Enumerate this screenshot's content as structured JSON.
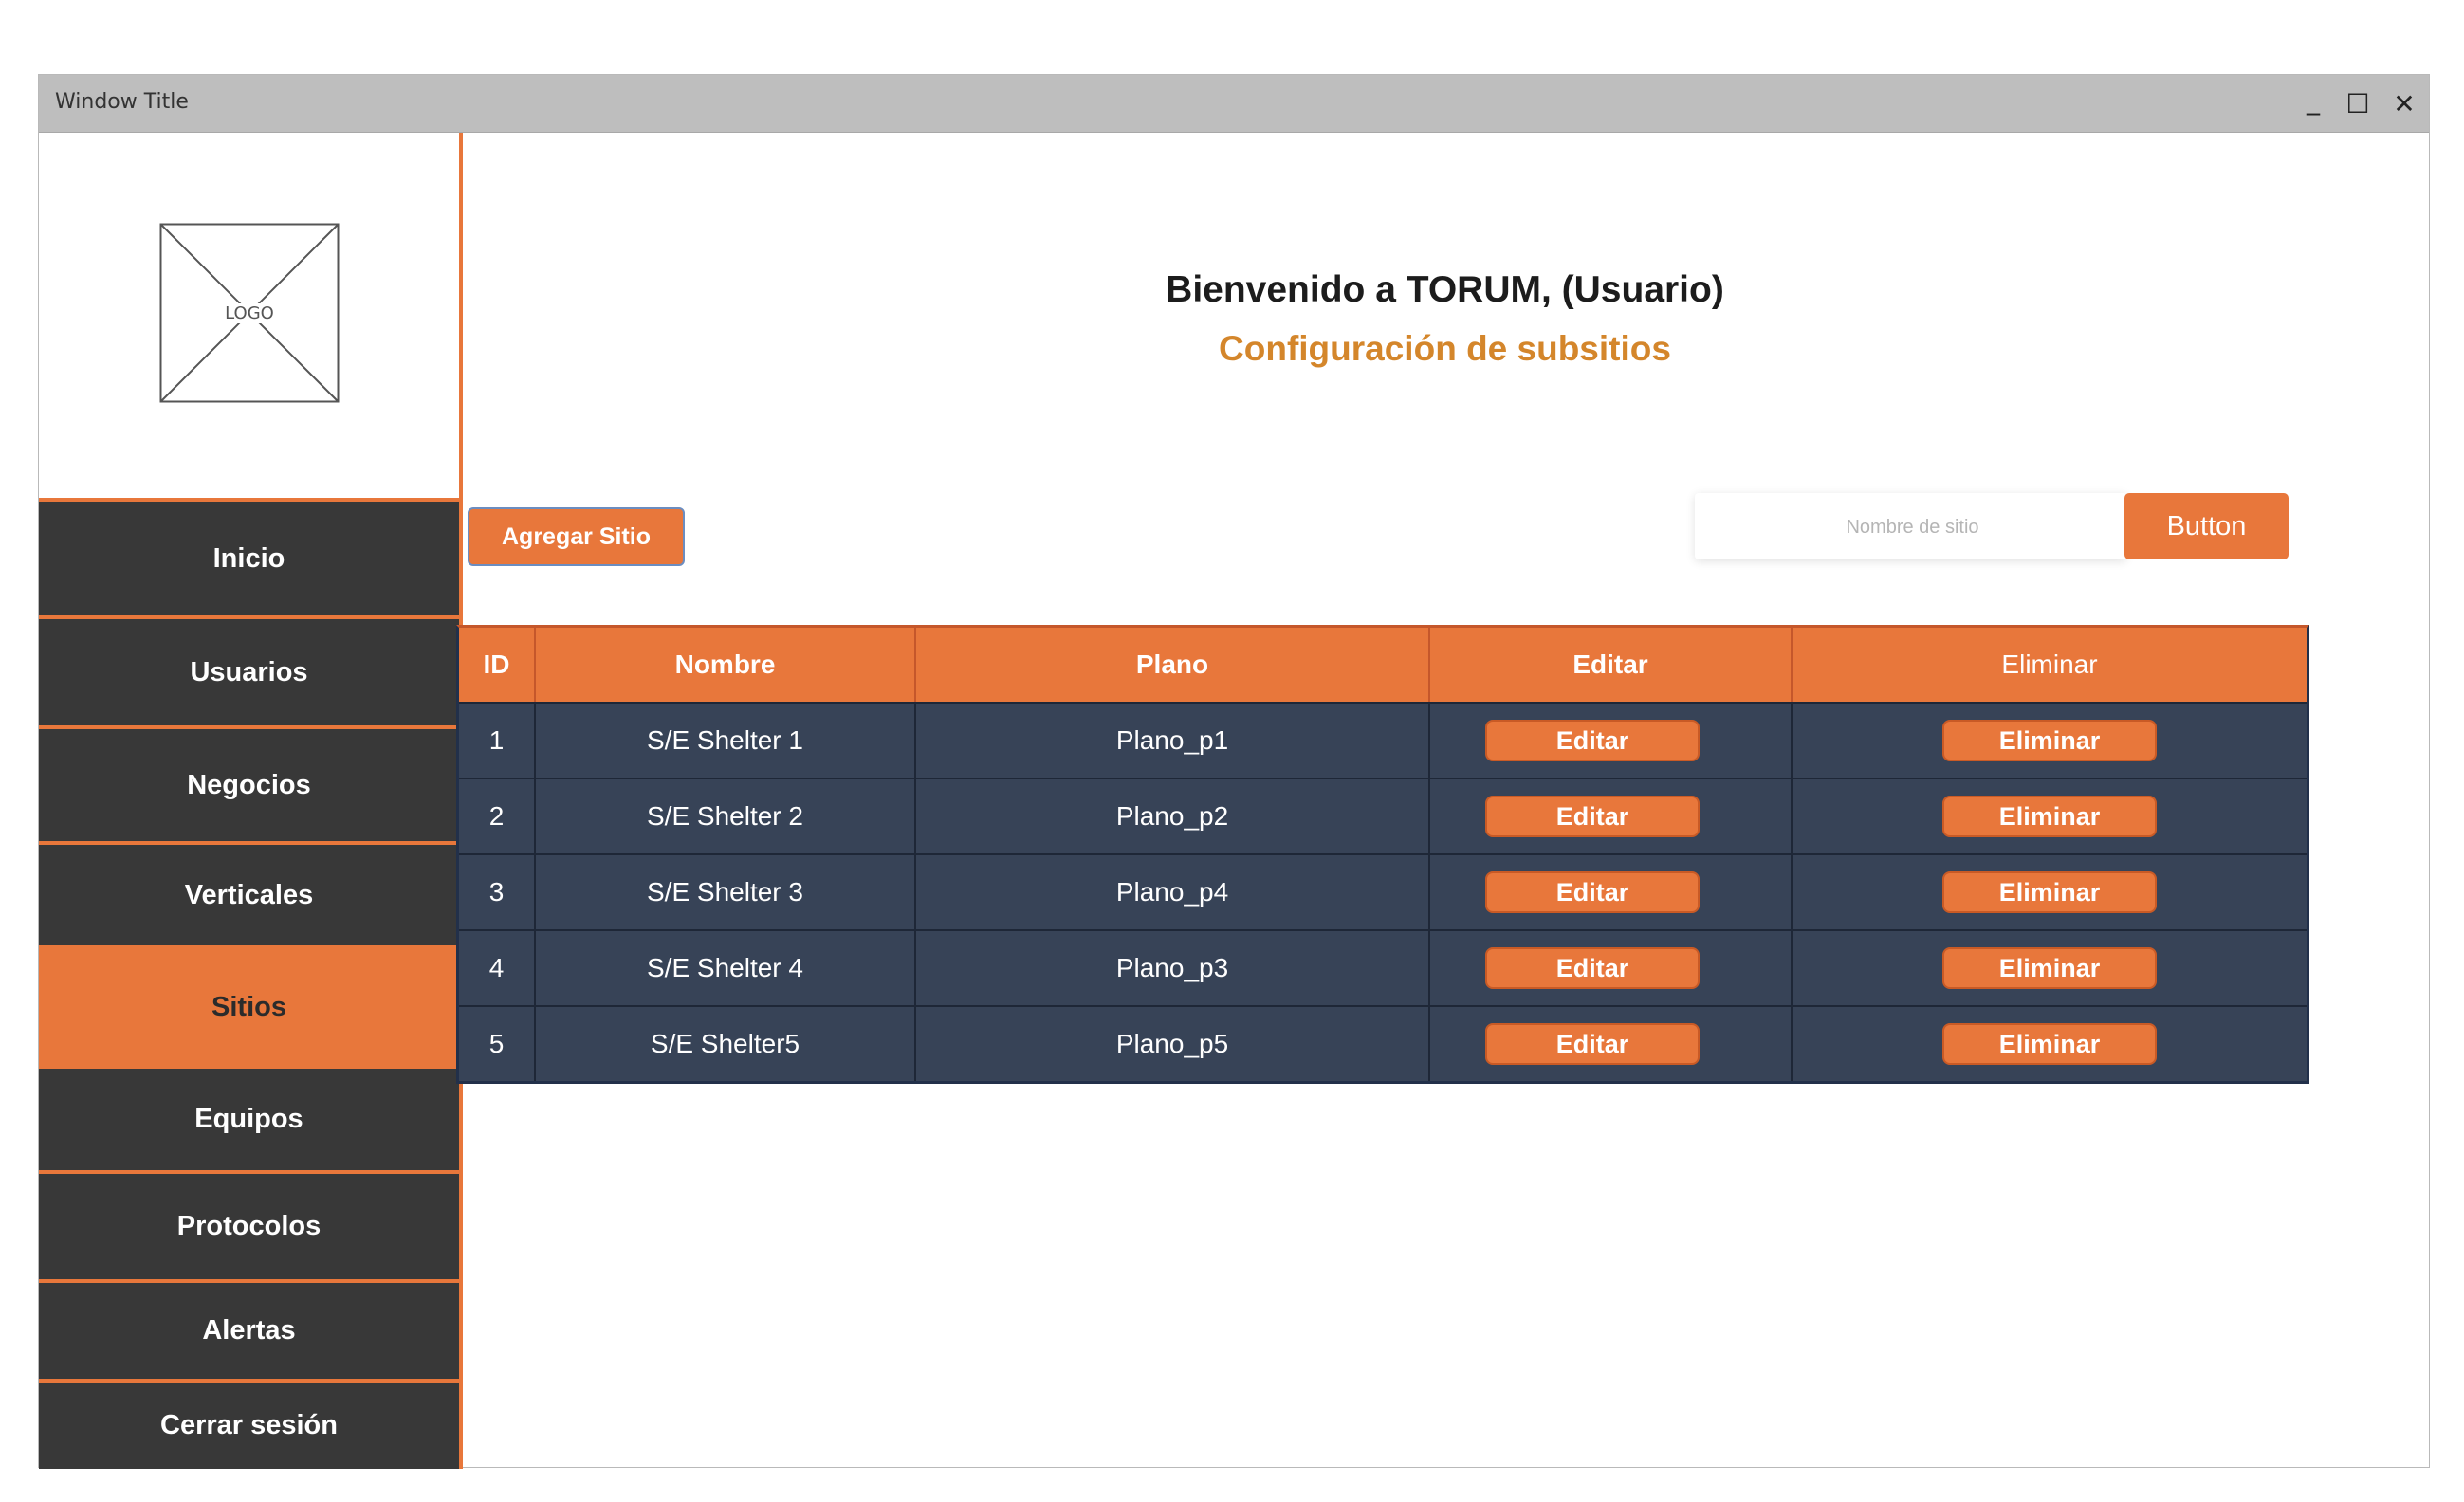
{
  "window": {
    "title": "Window Title",
    "minimize_glyph": "_",
    "maximize_glyph": "☐",
    "close_glyph": "✕"
  },
  "sidebar": {
    "logo_text": "LOGO",
    "items": [
      {
        "label": "Inicio",
        "active": false
      },
      {
        "label": "Usuarios",
        "active": false
      },
      {
        "label": "Negocios",
        "active": false
      },
      {
        "label": "Verticales",
        "active": false
      },
      {
        "label": "Sitios",
        "active": true
      },
      {
        "label": "Equipos",
        "active": false
      },
      {
        "label": "Protocolos",
        "active": false
      },
      {
        "label": "Alertas",
        "active": false
      },
      {
        "label": "Cerrar sesión",
        "active": false
      }
    ]
  },
  "main": {
    "welcome": "Bienvenido a TORUM, (Usuario)",
    "subtitle": "Configuración de subsitios",
    "add_button": "Agregar Sitio",
    "search": {
      "placeholder": "Nombre de sitio",
      "value": "",
      "button_label": "Button"
    },
    "table": {
      "columns": [
        "ID",
        "Nombre",
        "Plano",
        "Editar",
        "Eliminar"
      ],
      "rows": [
        {
          "id": "1",
          "nombre": "S/E Shelter 1",
          "plano": "Plano_p1",
          "edit_label": "Editar",
          "delete_label": "Eliminar"
        },
        {
          "id": "2",
          "nombre": "S/E Shelter 2",
          "plano": "Plano_p2",
          "edit_label": "Editar",
          "delete_label": "Eliminar"
        },
        {
          "id": "3",
          "nombre": "S/E Shelter 3",
          "plano": "Plano_p4",
          "edit_label": "Editar",
          "delete_label": "Eliminar"
        },
        {
          "id": "4",
          "nombre": "S/E Shelter 4",
          "plano": "Plano_p3",
          "edit_label": "Editar",
          "delete_label": "Eliminar"
        },
        {
          "id": "5",
          "nombre": "S/E Shelter5",
          "plano": "Plano_p5",
          "edit_label": "Editar",
          "delete_label": "Eliminar"
        }
      ]
    }
  },
  "colors": {
    "accent": "#e8773b",
    "sidebar_dark": "#383838",
    "table_body": "#374357",
    "subtitle": "#d4862b",
    "titlebar": "#bebebe"
  }
}
